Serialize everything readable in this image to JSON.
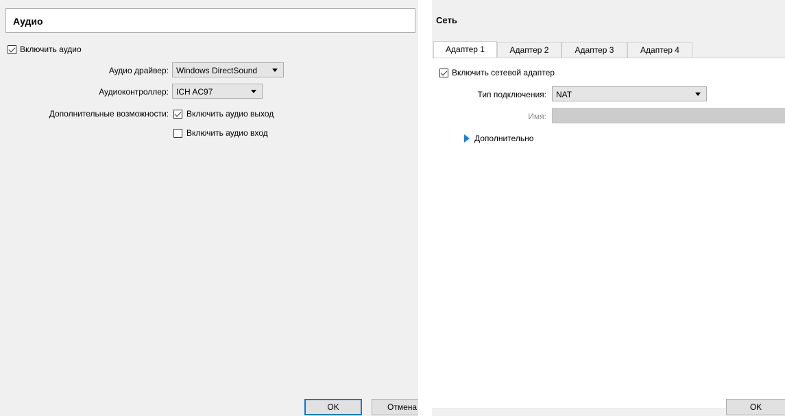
{
  "audio": {
    "title": "Аудио",
    "enable_audio": {
      "label": "Включить аудио",
      "checked": true
    },
    "driver": {
      "label": "Аудио драйвер:",
      "value": "Windows DirectSound"
    },
    "controller": {
      "label": "Аудиоконтроллер:",
      "value": "ICH AC97"
    },
    "extended": {
      "label": "Дополнительные возможности:",
      "output": {
        "label": "Включить аудио выход",
        "checked": true
      },
      "input": {
        "label": "Включить аудио вход",
        "checked": false
      }
    },
    "buttons": {
      "ok": "OK",
      "cancel": "Отмена"
    }
  },
  "network": {
    "title": "Сеть",
    "tabs": [
      {
        "label": "Адаптер 1",
        "active": true
      },
      {
        "label": "Адаптер 2",
        "active": false
      },
      {
        "label": "Адаптер 3",
        "active": false
      },
      {
        "label": "Адаптер 4",
        "active": false
      }
    ],
    "enable_adapter": {
      "label": "Включить сетевой адаптер",
      "checked": true
    },
    "attached_to": {
      "label": "Тип подключения:",
      "value": "NAT"
    },
    "name": {
      "label": "Имя:",
      "value": ""
    },
    "advanced": {
      "label": "Дополнительно"
    },
    "buttons": {
      "ok": "OK"
    }
  },
  "colors": {
    "accent": "#0078d7",
    "expander": "#1a7fd9",
    "panel_bg": "#f0f0f0"
  }
}
